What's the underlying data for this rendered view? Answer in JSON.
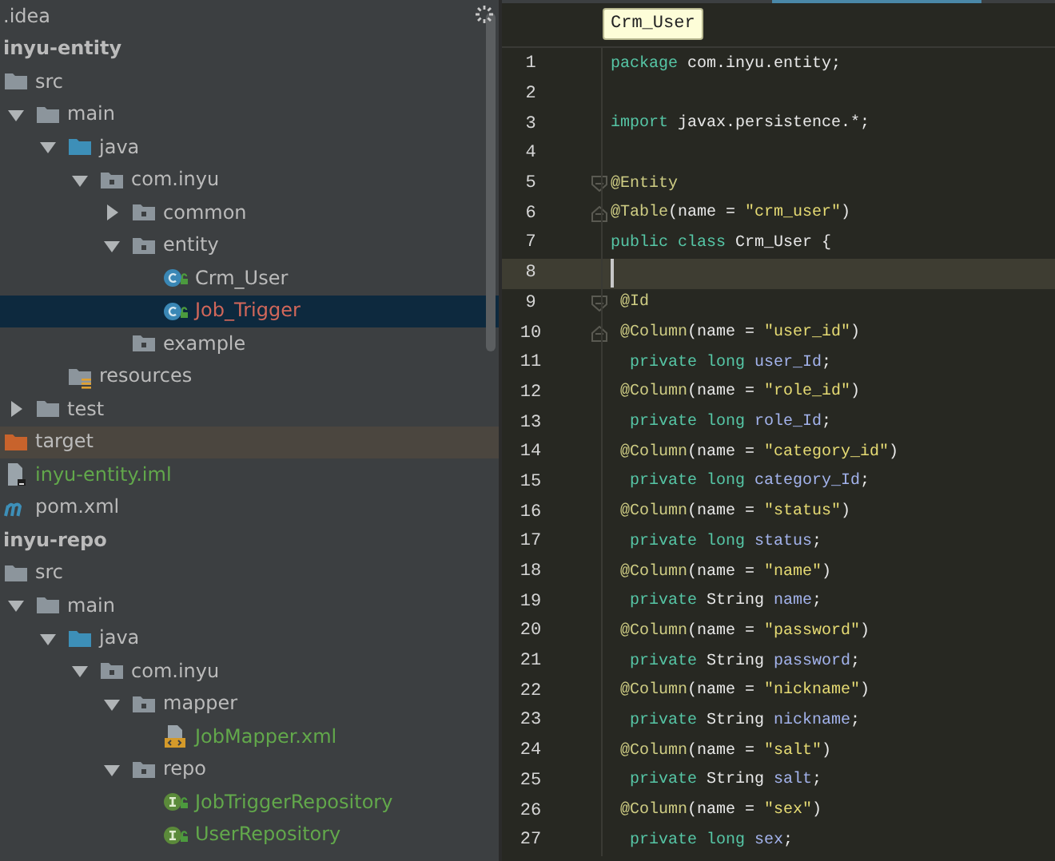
{
  "project_tree": {
    "items": [
      {
        "label": ".idea",
        "selected": false,
        "color": "#bbbbbb"
      },
      {
        "label": "inyu-entity",
        "kind": "module",
        "selected": false,
        "color": "#bbbbbb",
        "children": [
          {
            "label": "src",
            "kind": "folder",
            "selected": false,
            "color": "#bbbbbb",
            "children": [
              {
                "label": "main",
                "kind": "folder",
                "expanded": true,
                "selected": false,
                "color": "#bbbbbb",
                "children": [
                  {
                    "label": "java",
                    "kind": "source",
                    "expanded": true,
                    "selected": false,
                    "color": "#bbbbbb",
                    "children": [
                      {
                        "label": "com.inyu",
                        "kind": "package",
                        "expanded": true,
                        "selected": false,
                        "color": "#bbbbbb",
                        "children": [
                          {
                            "label": "common",
                            "kind": "package",
                            "expanded": false,
                            "selected": false,
                            "color": "#bbbbbb"
                          },
                          {
                            "label": "entity",
                            "kind": "package",
                            "expanded": true,
                            "selected": false,
                            "color": "#bbbbbb",
                            "children": [
                              {
                                "label": "Crm_User",
                                "kind": "class",
                                "selected": false,
                                "color": "#bbbbbb"
                              },
                              {
                                "label": "Job_Trigger",
                                "kind": "class",
                                "selected": true,
                                "color": "#d1675a"
                              }
                            ]
                          },
                          {
                            "label": "example",
                            "kind": "package",
                            "selected": false,
                            "color": "#bbbbbb"
                          }
                        ]
                      }
                    ]
                  },
                  {
                    "label": "resources",
                    "kind": "resources",
                    "selected": false,
                    "color": "#bbbbbb"
                  }
                ]
              },
              {
                "label": "test",
                "kind": "folder",
                "expanded": false,
                "selected": false,
                "color": "#bbbbbb"
              }
            ]
          },
          {
            "label": "target",
            "kind": "excluded",
            "selected": false,
            "color": "#bbbbbb"
          },
          {
            "label": "inyu-entity.iml",
            "kind": "iml",
            "selected": false,
            "color": "#62a84b"
          },
          {
            "label": "pom.xml",
            "kind": "maven",
            "selected": false,
            "color": "#bbbbbb"
          }
        ]
      },
      {
        "label": "inyu-repo",
        "kind": "module",
        "selected": false,
        "color": "#bbbbbb",
        "children": [
          {
            "label": "src",
            "kind": "folder",
            "selected": false,
            "color": "#bbbbbb",
            "children": [
              {
                "label": "main",
                "kind": "folder",
                "expanded": true,
                "selected": false,
                "color": "#bbbbbb",
                "children": [
                  {
                    "label": "java",
                    "kind": "source",
                    "expanded": true,
                    "selected": false,
                    "color": "#bbbbbb",
                    "children": [
                      {
                        "label": "com.inyu",
                        "kind": "package",
                        "expanded": true,
                        "selected": false,
                        "color": "#bbbbbb",
                        "children": [
                          {
                            "label": "mapper",
                            "kind": "package",
                            "expanded": true,
                            "selected": false,
                            "color": "#bbbbbb",
                            "children": [
                              {
                                "label": "JobMapper.xml",
                                "kind": "xml",
                                "selected": false,
                                "color": "#62a84b"
                              }
                            ]
                          },
                          {
                            "label": "repo",
                            "kind": "package",
                            "expanded": true,
                            "selected": false,
                            "color": "#bbbbbb",
                            "children": [
                              {
                                "label": "JobTriggerRepository",
                                "kind": "interface",
                                "selected": false,
                                "color": "#62a84b"
                              },
                              {
                                "label": "UserRepository",
                                "kind": "interface",
                                "selected": false,
                                "color": "#62a84b"
                              }
                            ]
                          }
                        ]
                      }
                    ]
                  }
                ]
              }
            ]
          }
        ]
      }
    ]
  },
  "editor": {
    "tooltip": "Crm_User",
    "lines": [
      {
        "number": "1",
        "current": false,
        "kind": "top",
        "tokens": [
          {
            "text": "package ",
            "kind": "keyword"
          },
          {
            "text": "com.inyu.entity;",
            "kind": "plain"
          }
        ]
      },
      {
        "number": "2",
        "current": false
      },
      {
        "number": "3",
        "current": false,
        "kind": "top",
        "tokens": [
          {
            "text": "import ",
            "kind": "keyword"
          },
          {
            "text": "javax.persistence.*;",
            "kind": "plain"
          }
        ]
      },
      {
        "number": "4",
        "current": false
      },
      {
        "number": "5",
        "current": false,
        "kind": "top",
        "fold_start": true,
        "tokens": [
          {
            "text": "@Entity",
            "kind": "annotation"
          }
        ]
      },
      {
        "number": "6",
        "current": false,
        "kind": "top",
        "fold_start": false,
        "tokens": [
          {
            "text": "@Table",
            "kind": "annotation"
          },
          {
            "text": "(name = ",
            "kind": "plain"
          },
          {
            "text": "\"crm_user\"",
            "kind": "string"
          },
          {
            "text": ")",
            "kind": "plain"
          }
        ]
      },
      {
        "number": "7",
        "current": false,
        "kind": "top",
        "tokens": [
          {
            "text": "public class ",
            "kind": "keyword"
          },
          {
            "text": "Crm_User {",
            "kind": "plain"
          }
        ]
      },
      {
        "number": "8",
        "current": true
      },
      {
        "number": "9",
        "current": false,
        "kind": "annotation",
        "fold_start": true,
        "tokens": [
          {
            "text": "@Id",
            "kind": "annotation"
          }
        ]
      },
      {
        "number": "10",
        "current": false,
        "kind": "annotation",
        "fold_start": false,
        "tokens": [
          {
            "text": "@Column",
            "kind": "annotation"
          },
          {
            "text": "(name = ",
            "kind": "plain"
          },
          {
            "text": "\"user_id\"",
            "kind": "string"
          },
          {
            "text": ")",
            "kind": "plain"
          }
        ]
      },
      {
        "number": "11",
        "current": false,
        "kind": "field",
        "tokens": [
          {
            "text": "private long ",
            "kind": "keyword"
          },
          {
            "text": "user_Id",
            "kind": "field"
          },
          {
            "text": ";",
            "kind": "plain"
          }
        ]
      },
      {
        "number": "12",
        "current": false,
        "kind": "annotation",
        "tokens": [
          {
            "text": "@Column",
            "kind": "annotation"
          },
          {
            "text": "(name = ",
            "kind": "plain"
          },
          {
            "text": "\"role_id\"",
            "kind": "string"
          },
          {
            "text": ")",
            "kind": "plain"
          }
        ]
      },
      {
        "number": "13",
        "current": false,
        "kind": "field",
        "tokens": [
          {
            "text": "private long ",
            "kind": "keyword"
          },
          {
            "text": "role_Id",
            "kind": "field"
          },
          {
            "text": ";",
            "kind": "plain"
          }
        ]
      },
      {
        "number": "14",
        "current": false,
        "kind": "annotation",
        "tokens": [
          {
            "text": "@Column",
            "kind": "annotation"
          },
          {
            "text": "(name = ",
            "kind": "plain"
          },
          {
            "text": "\"category_id\"",
            "kind": "string"
          },
          {
            "text": ")",
            "kind": "plain"
          }
        ]
      },
      {
        "number": "15",
        "current": false,
        "kind": "field",
        "tokens": [
          {
            "text": "private long ",
            "kind": "keyword"
          },
          {
            "text": "category_Id",
            "kind": "field"
          },
          {
            "text": ";",
            "kind": "plain"
          }
        ]
      },
      {
        "number": "16",
        "current": false,
        "kind": "annotation",
        "tokens": [
          {
            "text": "@Column",
            "kind": "annotation"
          },
          {
            "text": "(name = ",
            "kind": "plain"
          },
          {
            "text": "\"status\"",
            "kind": "string"
          },
          {
            "text": ")",
            "kind": "plain"
          }
        ]
      },
      {
        "number": "17",
        "current": false,
        "kind": "field",
        "tokens": [
          {
            "text": "private long ",
            "kind": "keyword"
          },
          {
            "text": "status",
            "kind": "field"
          },
          {
            "text": ";",
            "kind": "plain"
          }
        ]
      },
      {
        "number": "18",
        "current": false,
        "kind": "annotation",
        "tokens": [
          {
            "text": "@Column",
            "kind": "annotation"
          },
          {
            "text": "(name = ",
            "kind": "plain"
          },
          {
            "text": "\"name\"",
            "kind": "string"
          },
          {
            "text": ")",
            "kind": "plain"
          }
        ]
      },
      {
        "number": "19",
        "current": false,
        "kind": "field",
        "tokens": [
          {
            "text": "private ",
            "kind": "keyword"
          },
          {
            "text": "String ",
            "kind": "plain"
          },
          {
            "text": "name",
            "kind": "field"
          },
          {
            "text": ";",
            "kind": "plain"
          }
        ]
      },
      {
        "number": "20",
        "current": false,
        "kind": "annotation",
        "tokens": [
          {
            "text": "@Column",
            "kind": "annotation"
          },
          {
            "text": "(name = ",
            "kind": "plain"
          },
          {
            "text": "\"password\"",
            "kind": "string"
          },
          {
            "text": ")",
            "kind": "plain"
          }
        ]
      },
      {
        "number": "21",
        "current": false,
        "kind": "field",
        "tokens": [
          {
            "text": "private ",
            "kind": "keyword"
          },
          {
            "text": "String ",
            "kind": "plain"
          },
          {
            "text": "password",
            "kind": "field"
          },
          {
            "text": ";",
            "kind": "plain"
          }
        ]
      },
      {
        "number": "22",
        "current": false,
        "kind": "annotation",
        "tokens": [
          {
            "text": "@Column",
            "kind": "annotation"
          },
          {
            "text": "(name = ",
            "kind": "plain"
          },
          {
            "text": "\"nickname\"",
            "kind": "string"
          },
          {
            "text": ")",
            "kind": "plain"
          }
        ]
      },
      {
        "number": "23",
        "current": false,
        "kind": "field",
        "tokens": [
          {
            "text": "private ",
            "kind": "keyword"
          },
          {
            "text": "String ",
            "kind": "plain"
          },
          {
            "text": "nickname",
            "kind": "field"
          },
          {
            "text": ";",
            "kind": "plain"
          }
        ]
      },
      {
        "number": "24",
        "current": false,
        "kind": "annotation",
        "tokens": [
          {
            "text": "@Column",
            "kind": "annotation"
          },
          {
            "text": "(name = ",
            "kind": "plain"
          },
          {
            "text": "\"salt\"",
            "kind": "string"
          },
          {
            "text": ")",
            "kind": "plain"
          }
        ]
      },
      {
        "number": "25",
        "current": false,
        "kind": "field",
        "tokens": [
          {
            "text": "private ",
            "kind": "keyword"
          },
          {
            "text": "String ",
            "kind": "plain"
          },
          {
            "text": "salt",
            "kind": "field"
          },
          {
            "text": ";",
            "kind": "plain"
          }
        ]
      },
      {
        "number": "26",
        "current": false,
        "kind": "annotation",
        "tokens": [
          {
            "text": "@Column",
            "kind": "annotation"
          },
          {
            "text": "(name = ",
            "kind": "plain"
          },
          {
            "text": "\"sex\"",
            "kind": "string"
          },
          {
            "text": ")",
            "kind": "plain"
          }
        ]
      },
      {
        "number": "27",
        "current": false,
        "kind": "field",
        "tokens": [
          {
            "text": "private long ",
            "kind": "keyword"
          },
          {
            "text": "sex",
            "kind": "field"
          },
          {
            "text": ";",
            "kind": "plain"
          }
        ]
      }
    ]
  }
}
